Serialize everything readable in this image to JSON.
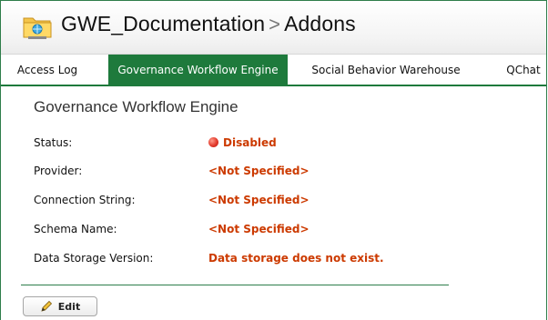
{
  "header": {
    "site": "GWE_Documentation",
    "separator": ">",
    "page": "Addons",
    "icon": "folder-icon"
  },
  "tabs": [
    {
      "label": "Access Log",
      "active": false
    },
    {
      "label": "Governance Workflow Engine",
      "active": true
    },
    {
      "label": "Social Behavior Warehouse",
      "active": false
    },
    {
      "label": "QChat",
      "active": false
    }
  ],
  "section": {
    "title": "Governance Workflow Engine"
  },
  "fields": [
    {
      "label": "Status:",
      "value": "Disabled",
      "icon": "status-disabled-icon"
    },
    {
      "label": "Provider:",
      "value": "<Not Specified>"
    },
    {
      "label": "Connection String:",
      "value": "<Not Specified>"
    },
    {
      "label": "Schema Name:",
      "value": "<Not Specified>"
    },
    {
      "label": "Data Storage Version:",
      "value": "Data storage does not exist."
    }
  ],
  "actions": {
    "edit_label": "Edit",
    "edit_icon": "pencil-icon"
  },
  "colors": {
    "accent_green": "#1e7a3c",
    "value_red": "#cc3a00"
  }
}
